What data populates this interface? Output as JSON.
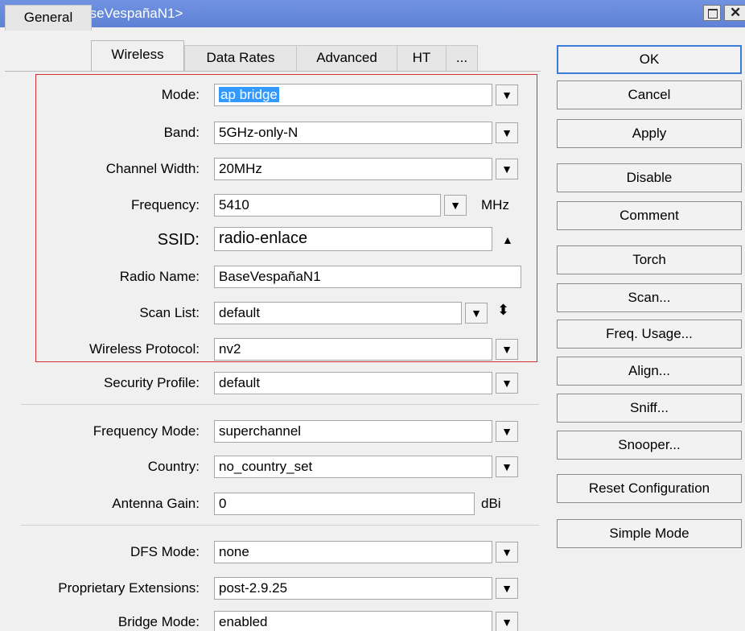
{
  "window": {
    "title": "Interface <BaseVespañaN1>",
    "maximize_icon": "maximize-icon",
    "close_icon": "close-icon"
  },
  "tabs": [
    {
      "label": "General"
    },
    {
      "label": "Wireless",
      "active": true
    },
    {
      "label": "Data Rates"
    },
    {
      "label": "Advanced"
    },
    {
      "label": "HT"
    },
    {
      "label": "..."
    }
  ],
  "fields": {
    "mode": {
      "label": "Mode:",
      "value": "ap bridge"
    },
    "band": {
      "label": "Band:",
      "value": "5GHz-only-N"
    },
    "channel_width": {
      "label": "Channel Width:",
      "value": "20MHz"
    },
    "frequency": {
      "label": "Frequency:",
      "value": "5410",
      "unit": "MHz"
    },
    "ssid": {
      "label": "SSID:",
      "value": "radio-enlace"
    },
    "radio_name": {
      "label": "Radio Name:",
      "value": "BaseVespañaN1"
    },
    "scan_list": {
      "label": "Scan List:",
      "value": "default"
    },
    "wireless_protocol": {
      "label": "Wireless Protocol:",
      "value": "nv2"
    },
    "security_profile": {
      "label": "Security Profile:",
      "value": "default"
    },
    "frequency_mode": {
      "label": "Frequency Mode:",
      "value": "superchannel"
    },
    "country": {
      "label": "Country:",
      "value": "no_country_set"
    },
    "antenna_gain": {
      "label": "Antenna Gain:",
      "value": "0",
      "unit": "dBi"
    },
    "dfs_mode": {
      "label": "DFS Mode:",
      "value": "none"
    },
    "proprietary_extensions": {
      "label": "Proprietary Extensions:",
      "value": "post-2.9.25"
    },
    "bridge_mode": {
      "label": "Bridge Mode:",
      "value": "enabled"
    }
  },
  "buttons": {
    "ok": "OK",
    "cancel": "Cancel",
    "apply": "Apply",
    "disable": "Disable",
    "comment": "Comment",
    "torch": "Torch",
    "scan": "Scan...",
    "freq_usage": "Freq. Usage...",
    "align": "Align...",
    "sniff": "Sniff...",
    "snooper": "Snooper...",
    "reset_configuration": "Reset Configuration",
    "simple_mode": "Simple Mode"
  },
  "colors": {
    "titlebar": "#6b8cdc",
    "selection": "#3399ff",
    "highlight_box": "#d43232",
    "ok_border": "#3d7bd8"
  }
}
